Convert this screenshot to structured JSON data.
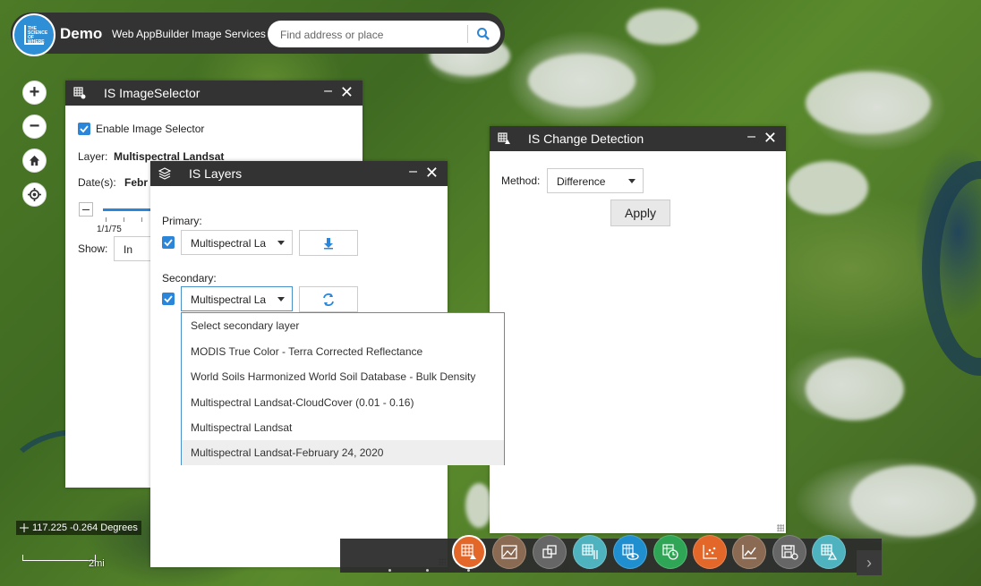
{
  "header": {
    "title": "Demo",
    "subtitle": "Web AppBuilder Image Services",
    "logo_text": "THE SCIENCE OF WHERE",
    "search_placeholder": "Find address or place"
  },
  "image_selector": {
    "title": "IS ImageSelector",
    "enable_label": "Enable Image Selector",
    "layer_label": "Layer:",
    "layer_value": "Multispectral Landsat",
    "dates_label": "Date(s):",
    "dates_value": "Febr",
    "slider_tick_label": "1/1/75",
    "show_label": "Show:",
    "show_value": "In"
  },
  "is_layers": {
    "title": "IS Layers",
    "primary_label": "Primary:",
    "primary_value": "Multispectral La",
    "secondary_label": "Secondary:",
    "secondary_value": "Multispectral La",
    "secondary_options": [
      "Select secondary layer",
      "MODIS True Color - Terra Corrected Reflectance",
      "World Soils Harmonized World Soil Database - Bulk Density",
      "Multispectral Landsat-CloudCover (0.01 - 0.16)",
      "Multispectral Landsat",
      "Multispectral Landsat-February 24, 2020"
    ],
    "selected_option_index": 5
  },
  "change_detection": {
    "title": "IS Change Detection",
    "method_label": "Method:",
    "method_value": "Difference",
    "apply_label": "Apply"
  },
  "status": {
    "coordinates": "117.225 -0.264 Degrees",
    "scale_label": "2mi"
  },
  "dock": {
    "icons": [
      {
        "name": "scatter-plot-icon",
        "color": "#e4672a"
      },
      {
        "name": "image-chart-icon",
        "color": "#8a6a52"
      },
      {
        "name": "layers-swap-icon",
        "color": "#666666"
      },
      {
        "name": "grid-settings-icon",
        "color": "#4fb3bf"
      },
      {
        "name": "grid-eye-icon",
        "color": "#1f8fcf"
      },
      {
        "name": "grid-clock-icon",
        "color": "#2ea655"
      },
      {
        "name": "scatter-dots-icon",
        "color": "#e4672a"
      },
      {
        "name": "line-chart-icon",
        "color": "#8a6a52"
      },
      {
        "name": "save-settings-icon",
        "color": "#666666"
      },
      {
        "name": "grid-change-icon",
        "color": "#4fb3bf"
      }
    ]
  },
  "colors": {
    "accent": "#2b86d9",
    "panel_title_bg": "#333333"
  }
}
